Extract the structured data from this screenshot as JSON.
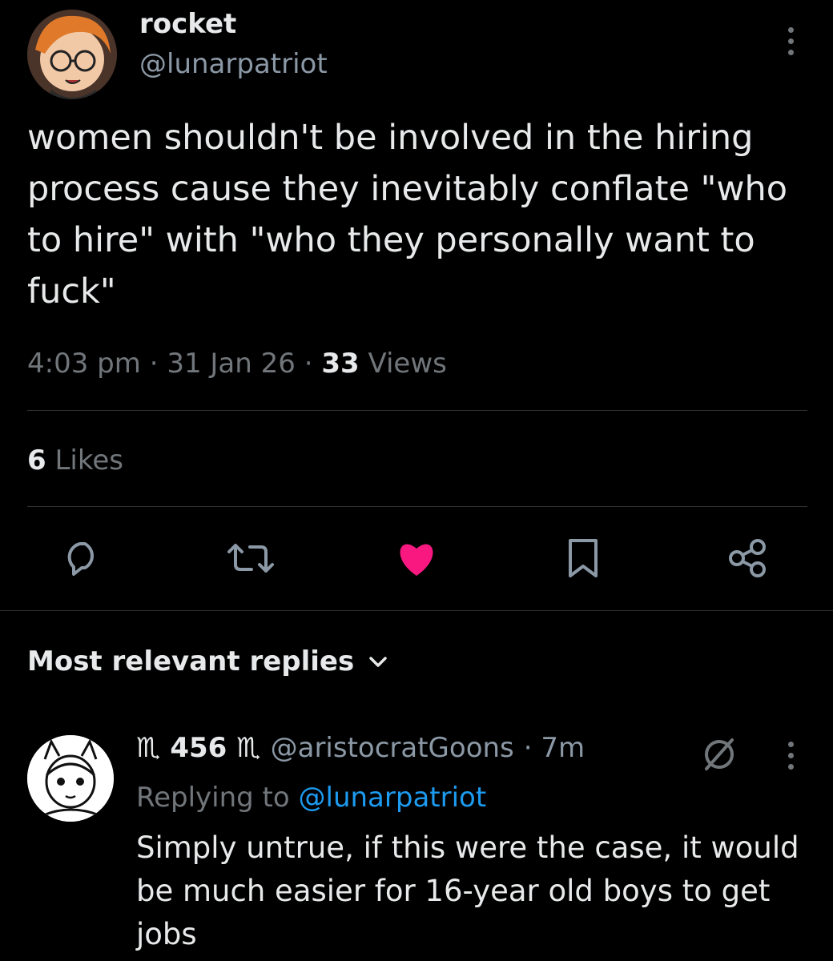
{
  "tweet": {
    "author_name": "rocket",
    "author_handle": "@lunarpatriot",
    "text": "women shouldn't be involved in the hiring process cause they inevitably conflate \"who to hire\" with \"who they personally want to fuck\"",
    "time": "4:03 pm",
    "separator": "·",
    "date": "31 Jan 26",
    "views_count": "33",
    "views_label": "Views",
    "likes_count": "6",
    "likes_label": "Likes",
    "liked": true,
    "actions": [
      "reply-icon",
      "retweet-icon",
      "like-icon",
      "bookmark-icon",
      "share-icon"
    ],
    "like_color": "#f91880"
  },
  "replies": {
    "sort_label": "Most relevant replies",
    "items": [
      {
        "author_name": "♏ 456 ♏",
        "author_handle": "@aristocratGoons",
        "time": "· 7m",
        "replying_prefix": "Replying to",
        "replying_handle": "@lunarpatriot",
        "text": "Simply untrue, if this were the case, it would be much easier for 16-year old boys to get jobs"
      }
    ]
  },
  "colors": {
    "background": "#000000",
    "text": "#e7e9ea",
    "muted": "#71767b",
    "link": "#1d9bf0"
  }
}
